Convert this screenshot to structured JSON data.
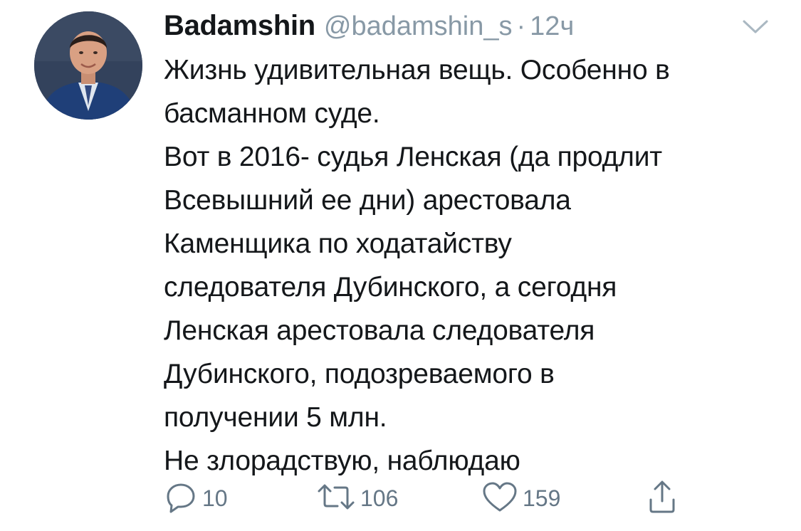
{
  "tweet": {
    "display_name": "Badamshin",
    "handle": "@badamshin_s",
    "separator": "·",
    "time": "12ч",
    "lines": [
      "Жизнь удивительная вещь. Особенно в",
      "басманном суде.",
      "Вот в 2016- судья Ленская (да продлит",
      "Всевышний ее дни) арестовала",
      "Каменщика по ходатайству",
      "следователя Дубинского, а сегодня",
      "Ленская арестовала следователя",
      "Дубинского, подозреваемого в",
      "получении 5 млн.",
      "Не злорадствую, наблюдаю"
    ]
  },
  "actions": {
    "reply_count": "10",
    "retweet_count": "106",
    "like_count": "159"
  },
  "icons": {
    "more": "chevron-down-icon",
    "reply": "reply-icon",
    "retweet": "retweet-icon",
    "like": "heart-icon",
    "share": "share-icon"
  },
  "colors": {
    "text": "#14171a",
    "secondary": "#8899a6",
    "action": "#657786"
  }
}
